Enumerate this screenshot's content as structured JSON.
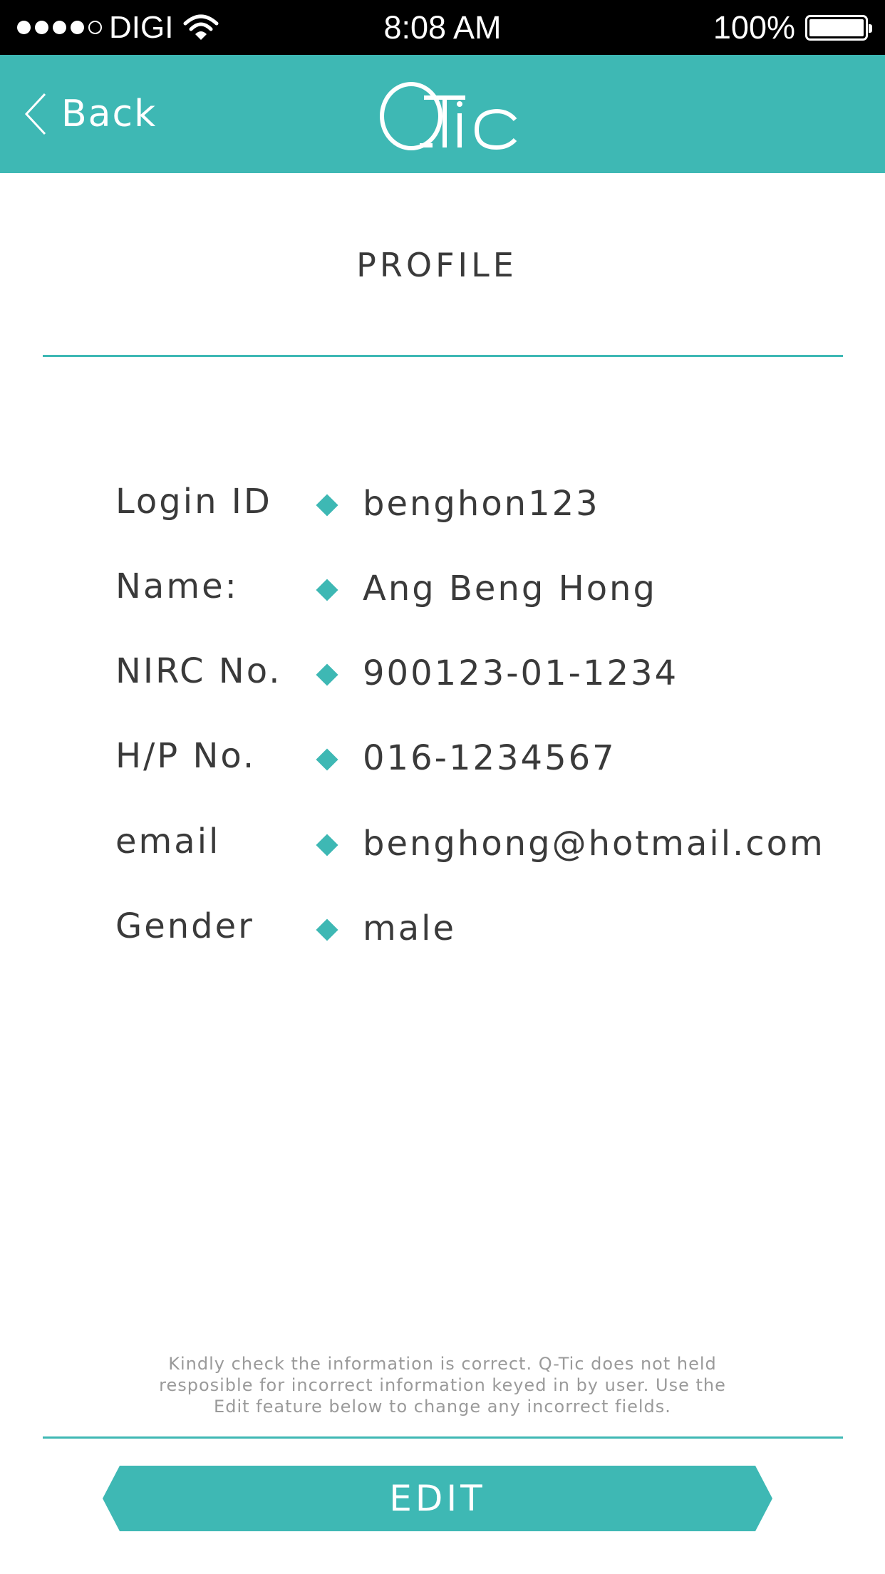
{
  "status_bar": {
    "signal_bars_filled": 4,
    "signal_bars_total": 5,
    "carrier": "DIGI",
    "time": "8:08 AM",
    "battery_percent": "100%",
    "icons": [
      "signal-dots-icon",
      "wifi-icon",
      "battery-icon"
    ]
  },
  "nav": {
    "back_label": "Back",
    "logo_text": "Qtic"
  },
  "page": {
    "title": "PROFILE"
  },
  "profile": {
    "rows": [
      {
        "label": "Login ID",
        "value": "benghon123"
      },
      {
        "label": "Name:",
        "value": "Ang Beng Hong"
      },
      {
        "label": "NIRC No.",
        "value": "900123-01-1234"
      },
      {
        "label": "H/P No.",
        "value": "016-1234567"
      },
      {
        "label": "email",
        "value": "benghong@hotmail.com"
      },
      {
        "label": "Gender",
        "value": "male"
      }
    ]
  },
  "footer": {
    "disclaimer": "Kindly check the information is correct. Q-Tic does not held resposible for incorrect information keyed in by user. Use the Edit feature below to change any incorrect fields.",
    "edit_label": "EDIT"
  },
  "colors": {
    "accent": "#3eb8b4",
    "status_bar": "#000000",
    "text": "#3a3a3a",
    "muted_text": "#9a9a9a"
  }
}
